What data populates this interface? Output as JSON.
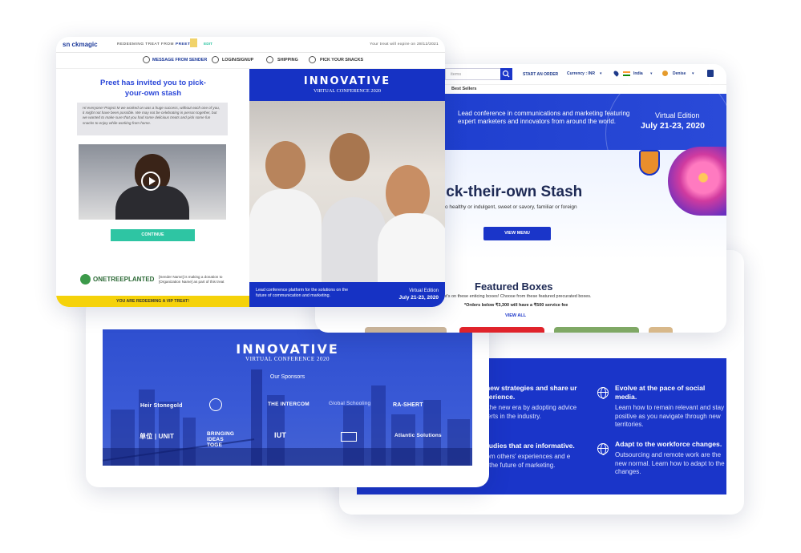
{
  "snack": {
    "logo": "sn ckmagic",
    "redeeming_prefix": "REDEEMING TREAT FROM",
    "sender": "PREET",
    "edit": "EDIT",
    "expiry": "Your treat will expire on 28/12/2021",
    "nav": [
      "MESSAGE FROM SENDER",
      "LOGIN/SIGNUP",
      "SHIPPING",
      "PICK YOUR SNACKS"
    ],
    "headline": "Preet has invited you to pick-your-own stash",
    "message": "Hi everyone! Project M we worked on was a huge success, without each one of you, it might not have been possible. We may not be celebrating in person together, but we wanted to make sure that you had some delicious treats and pick some fun snacks to enjoy while working from home.",
    "continue": "CONTINUE",
    "tree_logo": "ONETREEPLANTED",
    "donation": "[Sender Name] is making a donation to [Organization Name] as part of this treat",
    "vip": "YOU ARE REDEEMING A VIP TREAT!",
    "conf_logo": "INNOVATIVE",
    "conf_sub": "VIRTUAL CONFERENCE 2020",
    "conf_desc": "Lead conference platform for the solutions on the future of communication and marketing.",
    "edition": "Virtual Edition",
    "dates": "July 21-23, 2020"
  },
  "store": {
    "search_placeholder": "items",
    "start_order": "START AN ORDER",
    "currency": "Currency : INR",
    "country": "India",
    "user": "Denise",
    "best_sellers": "Best Sellers",
    "hero_text": "Lead conference in communications and marketing featuring expert marketers and innovators from around the world.",
    "edition": "Virtual Edition",
    "dates": "July 21-23, 2020",
    "headline": "ick-their-own Stash",
    "subline": "o healthy or indulgent, sweet or savory, familiar or foreign",
    "view_menu": "VIEW MENU",
    "featured_title": "Featured Boxes",
    "featured_desc": "ght's on these enticing boxes! Choose from these featured precurated boxes.",
    "order_note": "*Orders below ₹3,300 will have a ₹500 service fee",
    "view_all": "VIEW ALL"
  },
  "sponsors": {
    "logo": "INNOVATIVE",
    "sub": "VIRTUAL CONFERENCE 2020",
    "heading": "Our Sponsors",
    "names": [
      "Heir Stonegold",
      "",
      "THE INTERCOM",
      "Global Schooling",
      "RA-SHERT",
      "单位 | UNIT",
      "BRINGING IDEAS TOGE",
      "IUT",
      "",
      "Atlantic Solutions"
    ]
  },
  "features": {
    "items": [
      {
        "title": "rn new strategies and share ur experience.",
        "desc": "t to the new era by adopting advice experts in the industry."
      },
      {
        "title": "Evolve at the pace of social media.",
        "desc": "Learn how to remain relevant and stay positive as you navigate through new territories."
      },
      {
        "title": "e studies that are informative.",
        "desc": "n from others' experiences and e into the future of marketing."
      },
      {
        "title": "Adapt to the workforce changes.",
        "desc": "Outsourcing and remote work are the new normal. Learn how to adapt to the changes."
      }
    ]
  },
  "colors": {
    "brand_blue": "#1632c4",
    "accent_teal": "#2ec5a3",
    "vip_yellow": "#f5d20a",
    "headline_blue": "#2b47d8"
  }
}
